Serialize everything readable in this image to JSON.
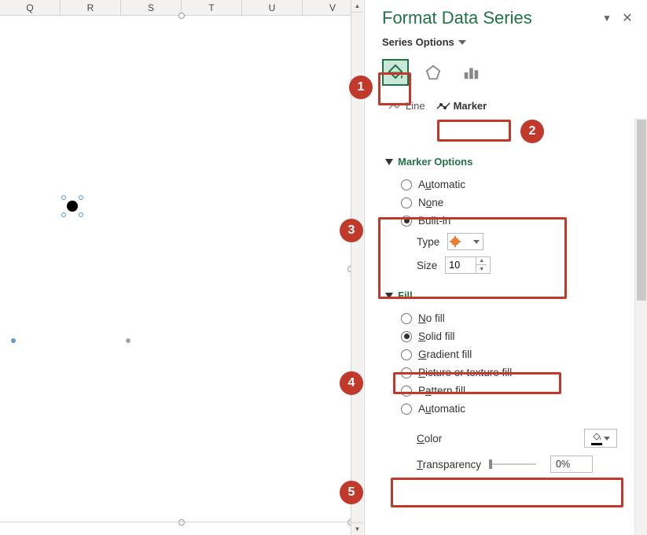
{
  "columns": [
    "Q",
    "R",
    "S",
    "T",
    "U",
    "V"
  ],
  "panel_title": "Format Data Series",
  "series_options_label": "Series Options",
  "tabs": {
    "line": "Line",
    "marker": "Marker"
  },
  "marker_options": {
    "header": "Marker Options",
    "automatic": "Automatic",
    "none": "None",
    "builtin": "Built-in",
    "none_u": "u",
    "type_label": "Type",
    "size_label": "Size",
    "size_value": "10"
  },
  "fill": {
    "header": "Fill",
    "no_fill": "No fill",
    "solid_fill": "Solid fill",
    "gradient_fill": "Gradient fill",
    "picture_fill": "Picture or texture fill",
    "pattern_fill": "Pattern fill",
    "automatic": "Automatic",
    "color_label": "Color",
    "transparency_label": "Transparency",
    "transparency_value": "0%"
  },
  "badges": {
    "b1": "1",
    "b2": "2",
    "b3": "3",
    "b4": "4",
    "b5": "5"
  }
}
